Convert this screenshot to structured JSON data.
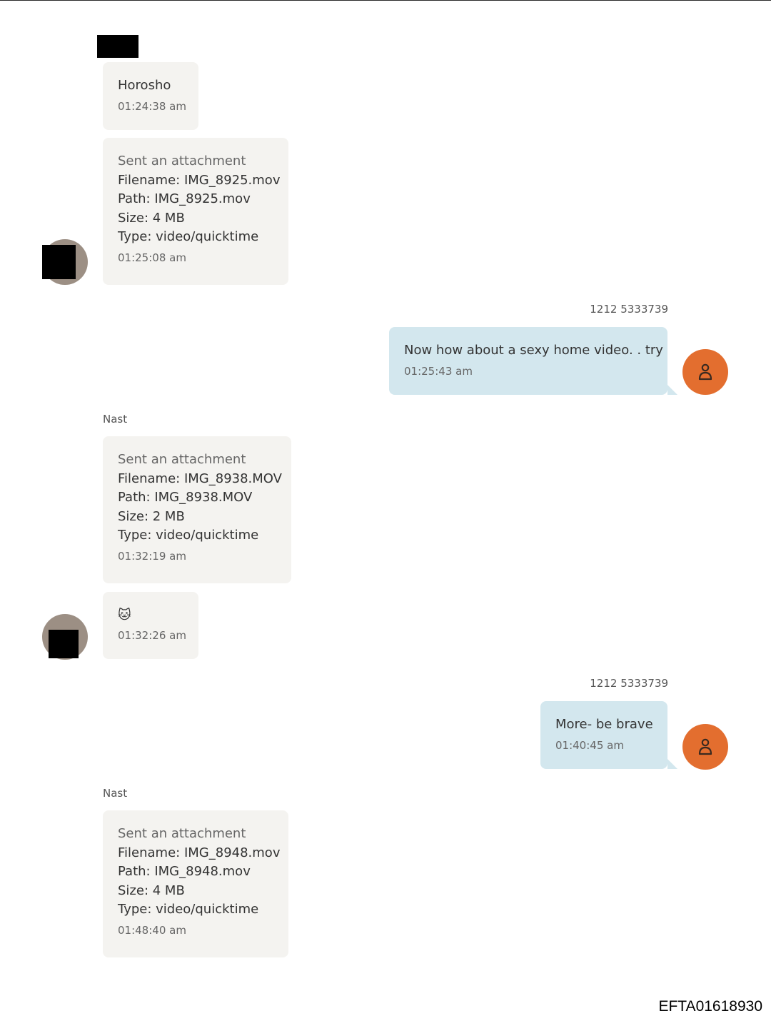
{
  "thread": {
    "messages": [
      {
        "direction": "in",
        "text": "Horosho",
        "time": "01:24:38 am"
      },
      {
        "direction": "in",
        "attachment": {
          "heading": "Sent an attachment",
          "filename": "Filename: IMG_8925.mov",
          "path": "Path: IMG_8925.mov",
          "size": "Size: 4 MB",
          "type": "Type: video/quicktime"
        },
        "time": "01:25:08 am"
      },
      {
        "direction": "out",
        "sender": "1212 5333739",
        "text": "Now how about a sexy home video. .  try",
        "time": "01:25:43 am"
      },
      {
        "direction": "in",
        "sender": "Nast",
        "attachment": {
          "heading": "Sent an attachment",
          "filename": "Filename: IMG_8938.MOV",
          "path": "Path: IMG_8938.MOV",
          "size": "Size: 2 MB",
          "type": "Type: video/quicktime"
        },
        "time": "01:32:19 am"
      },
      {
        "direction": "in",
        "text": "🐱",
        "time": "01:32:26 am"
      },
      {
        "direction": "out",
        "sender": "1212 5333739",
        "text": "More- be brave",
        "time": "01:40:45 am"
      },
      {
        "direction": "in",
        "sender": "Nast",
        "attachment": {
          "heading": "Sent an attachment",
          "filename": "Filename: IMG_8948.mov",
          "path": "Path: IMG_8948.mov",
          "size": "Size: 4 MB",
          "type": "Type: video/quicktime"
        },
        "time": "01:48:40 am"
      }
    ]
  },
  "footer": {
    "doc_id": "EFTA01618930"
  },
  "colors": {
    "incoming_bubble": "#f4f3f0",
    "outgoing_bubble": "#d3e7ee",
    "outgoing_avatar": "#e36e2f",
    "incoming_avatar": "#9c8f84"
  },
  "icons": {
    "outgoing_avatar": "person-icon",
    "redaction": "redaction-box"
  }
}
